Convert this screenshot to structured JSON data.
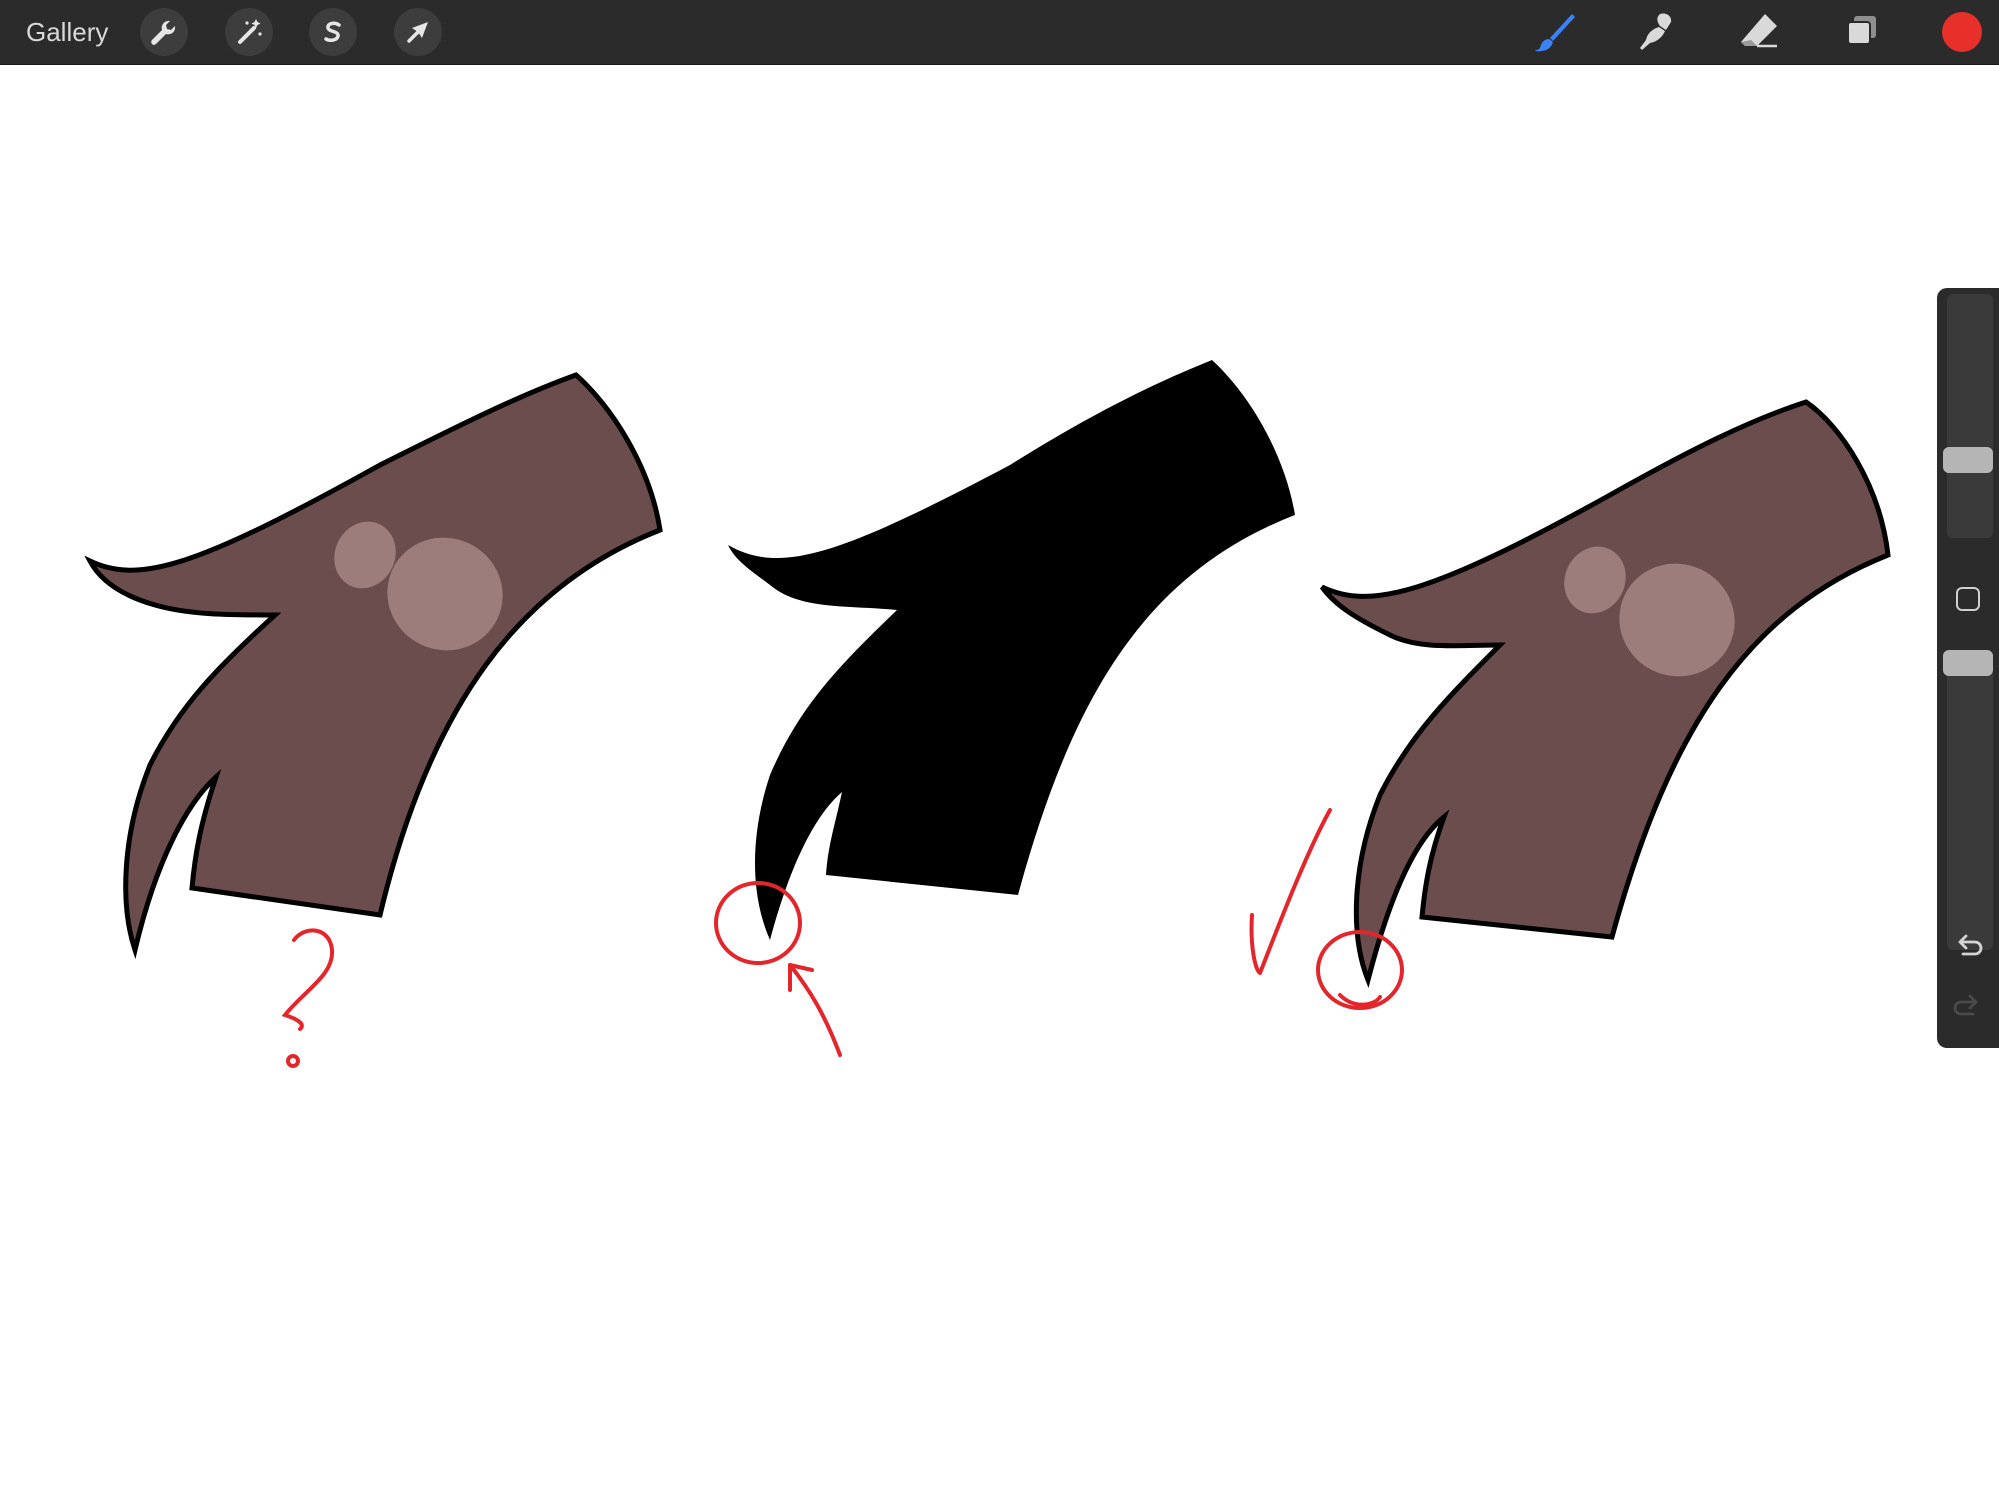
{
  "app": {
    "gallery_label": "Gallery"
  },
  "toolbar": {
    "left_icons": [
      "wrench-icon",
      "magic-wand-icon",
      "selection-s-icon",
      "move-arrow-icon"
    ],
    "right_icons": [
      "brush-icon",
      "smudge-icon",
      "eraser-icon",
      "layers-icon"
    ],
    "active_tool": "brush",
    "current_color": "#e8302a",
    "accent_color": "#3b82f6"
  },
  "sidebar": {
    "brush_size": 0.3,
    "opacity": 0.0,
    "icons": [
      "square-modifier-icon",
      "undo-icon",
      "redo-icon"
    ]
  },
  "canvas": {
    "colors": {
      "fill_brown": "#6b4d4e",
      "highlight": "#9d7c7c",
      "outline": "#000000",
      "annotation_red": "#e3262b"
    },
    "annotations": [
      "?",
      "✓"
    ]
  }
}
